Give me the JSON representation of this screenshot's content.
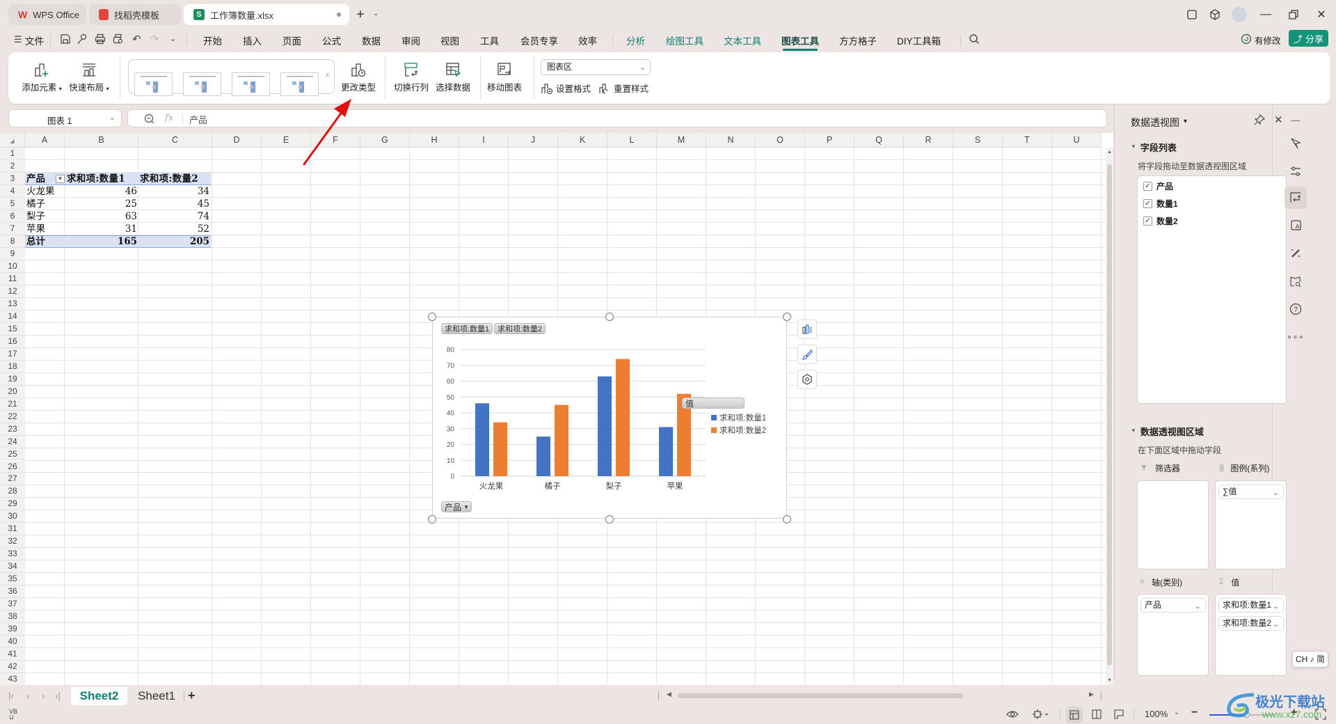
{
  "titlebar": {
    "tabs": [
      {
        "label": "WPS Office",
        "icon": "wps-logo-icon"
      },
      {
        "label": "找稻壳模板",
        "icon": "docer-icon"
      },
      {
        "label": "工作簿数量.xlsx",
        "icon": "spreadsheet-icon",
        "active": true
      }
    ],
    "new_tab": "+",
    "user_actions": {
      "changes_label": "有修改",
      "share_label": "分享"
    }
  },
  "menubar": {
    "file_label": "文件",
    "items": [
      "开始",
      "插入",
      "页面",
      "公式",
      "数据",
      "审阅",
      "视图",
      "工具",
      "会员专享",
      "效率",
      "分析",
      "绘图工具",
      "文本工具",
      "图表工具",
      "方方格子",
      "DIY工具箱"
    ],
    "active_item": "图表工具"
  },
  "ribbon": {
    "add_element": "添加元素",
    "quick_layout": "快速布局",
    "change_type": "更改类型",
    "switch_row_col": "切换行列",
    "select_data": "选择数据",
    "move_chart": "移动图表",
    "chart_area_select": "图表区",
    "set_format": "设置格式",
    "reset_style": "重置样式"
  },
  "formula_bar": {
    "name_box": "图表 1",
    "fx_label": "fx",
    "content": "产品"
  },
  "sheet": {
    "columns": [
      "A",
      "B",
      "C",
      "D",
      "E",
      "F",
      "G",
      "H",
      "I",
      "J",
      "K",
      "L",
      "M",
      "N",
      "O",
      "P",
      "Q",
      "R",
      "S",
      "T",
      "U"
    ],
    "row_count": 43,
    "pivot": {
      "headers": [
        "产品",
        "求和项:数量1",
        "求和项:数量2"
      ],
      "rows": [
        [
          "火龙果",
          "46",
          "34"
        ],
        [
          "橘子",
          "25",
          "45"
        ],
        [
          "梨子",
          "63",
          "74"
        ],
        [
          "苹果",
          "31",
          "52"
        ]
      ],
      "total": [
        "总计",
        "165",
        "205"
      ]
    }
  },
  "chart_data": {
    "type": "bar",
    "title": "",
    "categories": [
      "火龙果",
      "橘子",
      "梨子",
      "苹果"
    ],
    "series": [
      {
        "name": "求和项:数量1",
        "values": [
          46,
          25,
          63,
          31
        ],
        "color": "#4472c4"
      },
      {
        "name": "求和项:数量2",
        "values": [
          34,
          45,
          74,
          52
        ],
        "color": "#ed7d31"
      }
    ],
    "ylim": [
      0,
      80
    ],
    "yticks": [
      "0",
      "10",
      "20",
      "30",
      "40",
      "50",
      "60",
      "70",
      "80"
    ],
    "grid": true,
    "legend_title": "值",
    "legend_placement": "right",
    "field_buttons": [
      "求和项:数量1",
      "求和项:数量2"
    ],
    "axis_field_button": "产品",
    "xlabel": "",
    "ylabel": ""
  },
  "pivot_panel": {
    "title": "数据透视图",
    "field_list_header": "字段列表",
    "field_list_hint": "将字段拖动至数据透视图区域",
    "fields": [
      {
        "label": "产品",
        "checked": true
      },
      {
        "label": "数量1",
        "checked": true
      },
      {
        "label": "数量2",
        "checked": true
      }
    ],
    "area_header": "数据透视图区域",
    "area_hint": "在下面区域中拖动字段",
    "filter_label": "筛选器",
    "legend_label": "图例(系列)",
    "legend_items": [
      "∑值"
    ],
    "axis_label": "轴(类别)",
    "axis_items": [
      "产品"
    ],
    "values_label": "值",
    "values_items": [
      "求和项:数量1",
      "求和项:数量2"
    ]
  },
  "sheets": {
    "tabs": [
      "Sheet2",
      "Sheet1"
    ],
    "active": "Sheet2",
    "add": "+"
  },
  "statusbar": {
    "zoom": "100%"
  },
  "ime": {
    "label": "CH ♪ 简"
  },
  "watermark": {
    "text": "极光下载站",
    "url_text": "www.xz7.com"
  }
}
